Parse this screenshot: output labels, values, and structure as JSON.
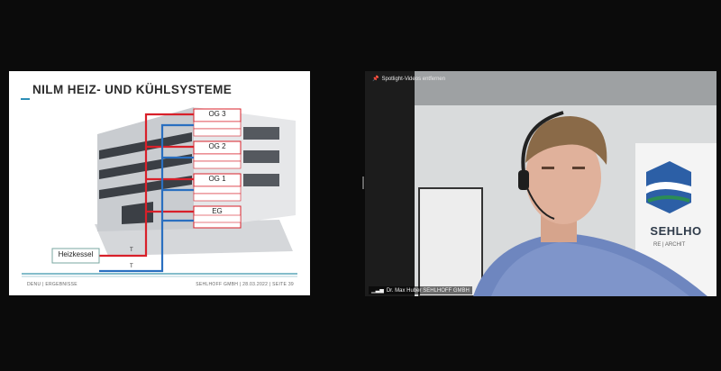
{
  "slide": {
    "title": "NILM HEIZ- UND KÜHLSYSTEME",
    "floors": [
      "OG 3",
      "OG 2",
      "OG 1",
      "EG"
    ],
    "boiler_label": "Heizkessel",
    "pipe_marks": [
      "T",
      "T"
    ],
    "footer_left": "DENU | ERGEBNISSE",
    "footer_right": "SEHLHOFF GMBH | 28.03.2022 | SEITE 39",
    "colors": {
      "hot": "#d8202a",
      "cold": "#2a6fc0",
      "accent": "#2e8fb7"
    }
  },
  "video": {
    "spotlight_label": "Spotlight-Videos entfernen",
    "participant_name": "Dr. Max Huber SEHLHOFF GMBH",
    "banner_text": "SEHLHO",
    "banner_sub": "RE | ARCHIT"
  }
}
